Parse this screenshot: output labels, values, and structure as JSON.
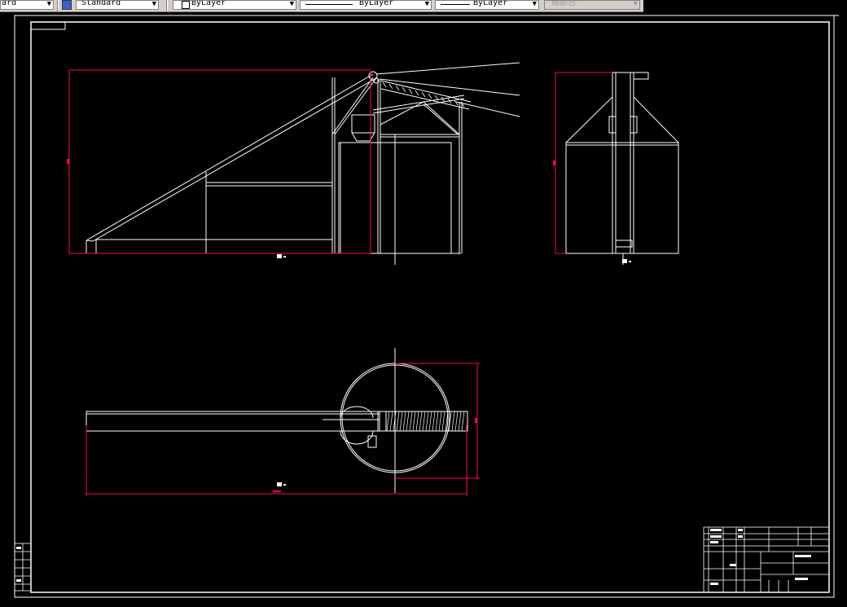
{
  "toolbar": {
    "text_style": "ard",
    "dim_style": "Standard",
    "layer": "ByLayer",
    "linetype": "ByLayer",
    "lineweight": "ByLayer",
    "color": "随颜色"
  },
  "colors": {
    "background": "#000000",
    "lines": "#ffffff",
    "dimensions": "#ff0066"
  },
  "icons": [
    "dropdown-arrow-icon",
    "dimstyle-icon",
    "layer-swatch-icon"
  ]
}
